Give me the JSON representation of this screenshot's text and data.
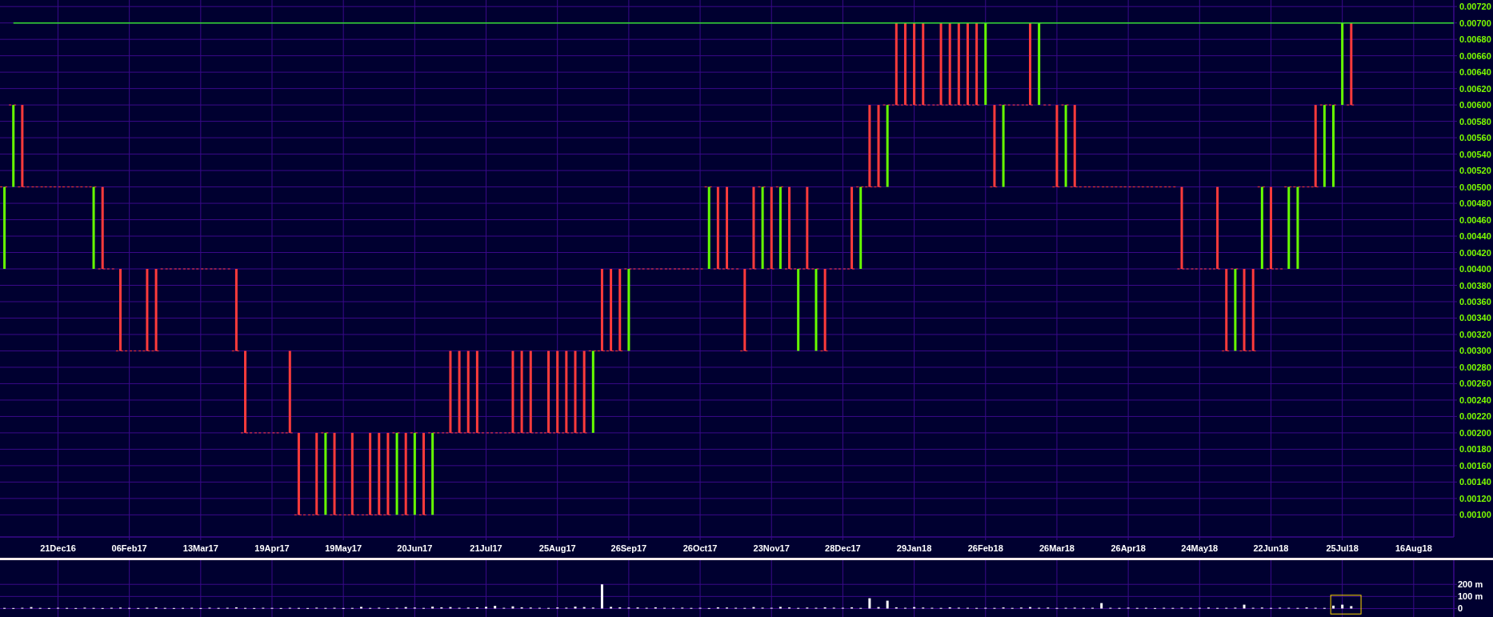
{
  "price_axis": {
    "labels": [
      "0.00720",
      "0.00700",
      "0.00680",
      "0.00660",
      "0.00640",
      "0.00620",
      "0.00600",
      "0.00580",
      "0.00560",
      "0.00540",
      "0.00520",
      "0.00500",
      "0.00480",
      "0.00460",
      "0.00440",
      "0.00420",
      "0.00400",
      "0.00380",
      "0.00360",
      "0.00340",
      "0.00320",
      "0.00300",
      "0.00280",
      "0.00260",
      "0.00240",
      "0.00220",
      "0.00200",
      "0.00180",
      "0.00160",
      "0.00140",
      "0.00120",
      "0.00100"
    ]
  },
  "date_axis": {
    "labels": [
      "21Dec16",
      "06Feb17",
      "13Mar17",
      "19Apr17",
      "19May17",
      "20Jun17",
      "21Jul17",
      "25Aug17",
      "26Sep17",
      "26Oct17",
      "23Nov17",
      "28Dec17",
      "29Jan18",
      "26Feb18",
      "26Mar18",
      "26Apr18",
      "24May18",
      "22Jun18",
      "25Jul18",
      "16Aug18"
    ]
  },
  "volume_chart": {
    "chart_data": {
      "type": "bar",
      "grid": true,
      "categories": [
        null,
        null,
        null,
        null,
        null,
        null,
        null,
        null,
        null,
        null,
        null,
        null,
        null,
        null,
        null,
        null,
        null,
        null,
        null,
        null,
        null,
        null,
        null,
        null,
        null,
        null,
        null,
        null,
        null,
        null,
        null,
        null,
        null,
        null,
        null,
        null,
        null,
        null,
        null,
        null,
        null,
        null,
        null,
        null,
        null,
        null,
        null,
        null,
        null,
        null,
        null,
        null,
        null,
        null,
        null,
        null,
        null,
        null,
        null,
        null,
        null,
        null,
        null,
        null,
        null,
        null,
        null,
        null,
        null,
        null,
        null,
        null,
        null,
        null,
        null,
        null,
        null,
        null,
        null,
        null,
        null,
        null,
        null,
        null,
        null,
        null,
        null,
        null,
        null,
        null,
        null,
        null,
        null,
        null,
        null,
        null,
        null,
        null,
        null,
        null,
        null,
        null,
        null,
        null,
        null,
        null,
        null,
        null,
        null,
        null,
        null,
        null,
        null,
        null,
        null,
        null,
        null,
        null,
        null,
        null,
        null,
        null,
        null,
        null,
        null,
        null,
        null,
        null,
        null,
        null,
        null,
        null,
        null,
        null,
        null,
        null,
        null,
        null,
        null,
        null,
        null,
        null,
        null,
        null,
        null,
        null,
        null,
        null,
        null,
        null,
        null,
        null,
        null,
        null,
        null,
        null,
        null,
        null,
        null,
        null,
        null,
        null,
        null
      ],
      "values": [
        5,
        4,
        6,
        12,
        5,
        4,
        6,
        5,
        4,
        7,
        5,
        4,
        6,
        8,
        5,
        4,
        6,
        9,
        5,
        4,
        5,
        6,
        4,
        7,
        5,
        6,
        10,
        5,
        4,
        6,
        5,
        4,
        6,
        5,
        4,
        7,
        5,
        6,
        4,
        5,
        14,
        5,
        7,
        4,
        6,
        12,
        8,
        5,
        16,
        10,
        12,
        6,
        8,
        10,
        14,
        22,
        6,
        18,
        10,
        8,
        6,
        5,
        9,
        7,
        16,
        12,
        8,
        200,
        14,
        10,
        8,
        9,
        6,
        10,
        6,
        5,
        7,
        5,
        6,
        4,
        10,
        8,
        6,
        5,
        12,
        7,
        6,
        14,
        9,
        5,
        8,
        6,
        10,
        7,
        6,
        10,
        5,
        85,
        12,
        65,
        10,
        6,
        12,
        8,
        6,
        5,
        10,
        7,
        6,
        5,
        6,
        5,
        9,
        5,
        8,
        12,
        6,
        8,
        5,
        6,
        7,
        5,
        6,
        45,
        6,
        5,
        7,
        5,
        6,
        4,
        6,
        5,
        7,
        5,
        6,
        8,
        5,
        6,
        7,
        32,
        6,
        8,
        5,
        7,
        6,
        5,
        9,
        6,
        5,
        24,
        32,
        20,
        null,
        null,
        null,
        null,
        null,
        null,
        null,
        null,
        null,
        null,
        null
      ],
      "ylim": [
        -70,
        400
      ],
      "yticks": [
        {
          "value": 0,
          "label": "0"
        },
        {
          "value": 100,
          "label": "100 m"
        },
        {
          "value": 200,
          "label": "200 m"
        }
      ]
    }
  }
}
